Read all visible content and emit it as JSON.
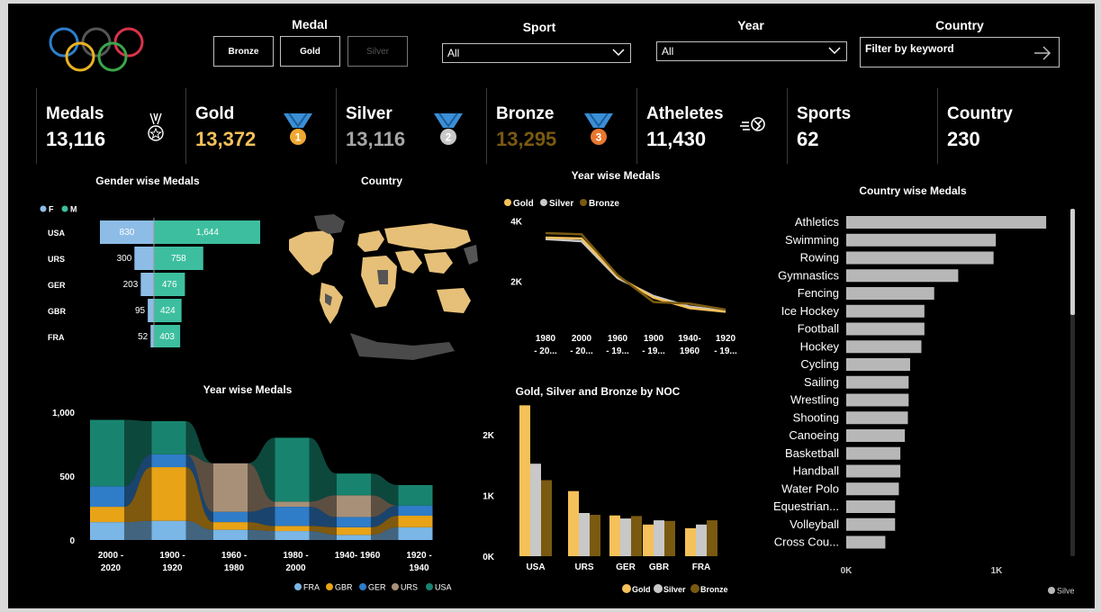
{
  "colors": {
    "gold": "#f5c15a",
    "silver": "#c8c8c8",
    "bronze": "#7a5a10",
    "F": "#8dbde6",
    "M": "#3dbf9f",
    "FRA": "#7ab6e6",
    "GBR": "#e8a317",
    "GER": "#2f7cc8",
    "URS": "#a89078",
    "USA": "#18846f",
    "bar": "#b7b7b7"
  },
  "filters": {
    "medal": {
      "title": "Medal",
      "options": [
        "Bronze",
        "Gold",
        "Silver"
      ]
    },
    "sport": {
      "title": "Sport",
      "value": "All"
    },
    "year": {
      "title": "Year",
      "value": "All"
    },
    "country": {
      "title": "Country",
      "placeholder": "Filter by keyword"
    }
  },
  "kpis": [
    {
      "title": "Medals",
      "value": "13,116",
      "icon": "medal-star-icon",
      "color": "#ffffff"
    },
    {
      "title": "Gold",
      "value": "13,372",
      "icon": "gold-medal-icon",
      "color": "#f5c15a"
    },
    {
      "title": "Silver",
      "value": "13,116",
      "icon": "silver-medal-icon",
      "color": "#a6a6a6"
    },
    {
      "title": "Bronze",
      "value": "13,295",
      "icon": "bronze-medal-icon",
      "color": "#7a5a10"
    },
    {
      "title": "Atheletes",
      "value": "11,430",
      "icon": "runner-icon",
      "color": "#ffffff"
    },
    {
      "title": "Sports",
      "value": "62",
      "icon": "",
      "color": "#ffffff"
    },
    {
      "title": "Country",
      "value": "230",
      "icon": "",
      "color": "#ffffff"
    }
  ],
  "chart_data": [
    {
      "id": "gender",
      "type": "bar",
      "orientation": "horizontal",
      "title": "Gender wise Medals",
      "legend": [
        "F",
        "M"
      ],
      "categories": [
        "USA",
        "URS",
        "GER",
        "GBR",
        "FRA"
      ],
      "series": [
        {
          "name": "F",
          "values": [
            830,
            300,
            203,
            95,
            52
          ],
          "labels": [
            "830",
            "300",
            "203",
            "95",
            "52"
          ]
        },
        {
          "name": "M",
          "values": [
            1644,
            758,
            476,
            424,
            403
          ],
          "labels": [
            "1,644",
            "758",
            "476",
            "424",
            "403"
          ]
        }
      ]
    },
    {
      "id": "map",
      "type": "map",
      "title": "Country"
    },
    {
      "id": "yearline",
      "type": "line",
      "title": "Year wise Medals",
      "legend": [
        "Gold",
        "Silver",
        "Bronze"
      ],
      "categories": [
        "1980 - 20...",
        "2000 - 20...",
        "1960 - 19...",
        "1900 - 19...",
        "1940- 1960",
        "1920 - 19..."
      ],
      "yticks": [
        "2K",
        "4K"
      ],
      "ylim": [
        0,
        4200
      ],
      "series": [
        {
          "name": "Gold",
          "values": [
            3450,
            3420,
            2150,
            1450,
            1100,
            980
          ]
        },
        {
          "name": "Silver",
          "values": [
            3400,
            3330,
            2100,
            1500,
            1150,
            1000
          ]
        },
        {
          "name": "Bronze",
          "values": [
            3600,
            3560,
            2200,
            1300,
            1250,
            1050
          ]
        }
      ]
    },
    {
      "id": "ribbon",
      "type": "area",
      "title": "Year wise Medals",
      "legend": [
        "FRA",
        "GBR",
        "GER",
        "URS",
        "USA"
      ],
      "categories": [
        "2000 - 2020",
        "1900 - 1920",
        "1960 - 1980",
        "1980 - 2000",
        "1940- 1960",
        "1920 - 1940"
      ],
      "yticks": [
        "0",
        "500",
        "1,000"
      ],
      "ylim": [
        0,
        1000
      ],
      "series": [
        {
          "name": "FRA",
          "values": [
            140,
            150,
            80,
            70,
            40,
            100
          ]
        },
        {
          "name": "GBR",
          "values": [
            120,
            420,
            60,
            40,
            60,
            90
          ]
        },
        {
          "name": "GER",
          "values": [
            160,
            100,
            80,
            150,
            80,
            80
          ]
        },
        {
          "name": "URS",
          "values": [
            0,
            0,
            380,
            40,
            170,
            0
          ]
        },
        {
          "name": "USA",
          "values": [
            520,
            260,
            0,
            500,
            170,
            160
          ]
        }
      ]
    },
    {
      "id": "noc",
      "type": "bar",
      "title": "Gold, Silver and Bronze by NOC",
      "legend": [
        "Gold",
        "Silver",
        "Bronze"
      ],
      "categories": [
        "USA",
        "URS",
        "GER",
        "GBR",
        "FRA"
      ],
      "yticks": [
        "0K",
        "1K",
        "2K"
      ],
      "ylim": [
        0,
        2500
      ],
      "series": [
        {
          "name": "Gold",
          "values": [
            2480,
            1070,
            670,
            520,
            460
          ]
        },
        {
          "name": "Silver",
          "values": [
            1520,
            710,
            620,
            590,
            520
          ]
        },
        {
          "name": "Bronze",
          "values": [
            1250,
            680,
            660,
            580,
            590
          ]
        }
      ]
    },
    {
      "id": "sports",
      "type": "bar",
      "orientation": "horizontal",
      "title": "Country wise Medals",
      "legend": [
        "Silver"
      ],
      "xticks": [
        "0K",
        "1K"
      ],
      "xlim": [
        0,
        1300
      ],
      "categories": [
        "Athletics",
        "Swimming",
        "Rowing",
        "Gymnastics",
        "Fencing",
        "Ice Hockey",
        "Football",
        "Hockey",
        "Cycling",
        "Sailing",
        "Wrestling",
        "Shooting",
        "Canoeing",
        "Basketball",
        "Handball",
        "Water Polo",
        "Equestrian...",
        "Volleyball",
        "Cross Cou..."
      ],
      "values": [
        1330,
        995,
        980,
        745,
        585,
        520,
        520,
        500,
        425,
        415,
        415,
        410,
        390,
        360,
        360,
        350,
        325,
        325,
        260
      ]
    }
  ]
}
